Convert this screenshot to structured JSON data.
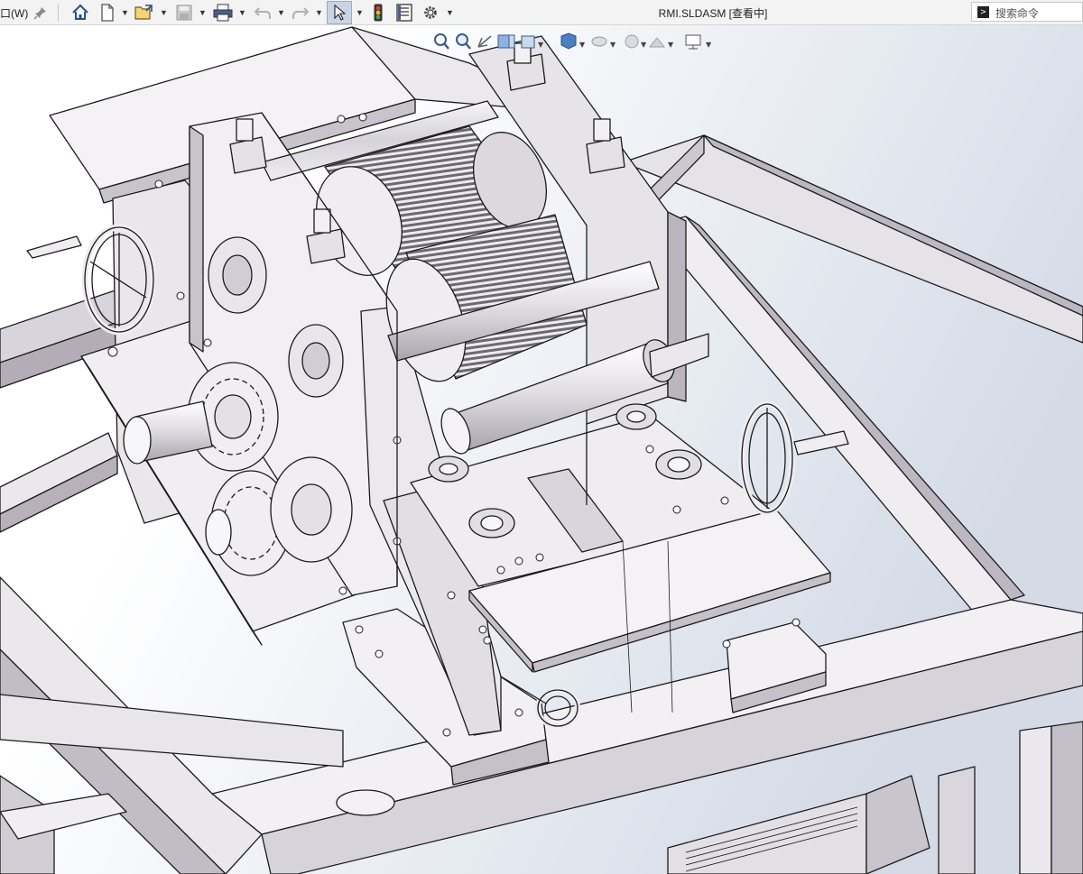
{
  "app": {
    "menu_fragment": "口(W)",
    "document_title": "RMI.SLDASM [查看中]",
    "search_placeholder": "搜索命令",
    "accent": "#d8a11a",
    "background_gradient": [
      "#ffffff",
      "#d3dbe7"
    ]
  },
  "toolbar": {
    "items": [
      {
        "name": "pin-icon"
      },
      {
        "name": "home-icon"
      },
      {
        "name": "new-document-icon"
      },
      {
        "name": "open-icon"
      },
      {
        "name": "save-icon"
      },
      {
        "name": "print-icon"
      },
      {
        "name": "undo-icon"
      },
      {
        "name": "redo-icon"
      },
      {
        "name": "select-arrow-icon"
      },
      {
        "name": "rebuild-traffic-light-icon"
      },
      {
        "name": "file-properties-icon"
      },
      {
        "name": "options-gear-icon"
      }
    ]
  },
  "heads_up_toolbar": {
    "items": [
      {
        "name": "zoom-to-fit-icon"
      },
      {
        "name": "zoom-to-area-icon"
      },
      {
        "name": "previous-view-icon"
      },
      {
        "name": "section-view-icon"
      },
      {
        "name": "view-orientation-icon"
      },
      {
        "name": "display-style-icon"
      },
      {
        "name": "hide-show-items-icon"
      },
      {
        "name": "edit-appearance-icon"
      },
      {
        "name": "apply-scene-icon"
      },
      {
        "name": "view-settings-monitor-icon"
      }
    ]
  },
  "model": {
    "name": "cad-assembly-model",
    "edge_color": "#1b1b1b",
    "face_light": "#f2f0f3",
    "face_mid": "#dcd8de",
    "face_dark": "#b8b2bc"
  }
}
